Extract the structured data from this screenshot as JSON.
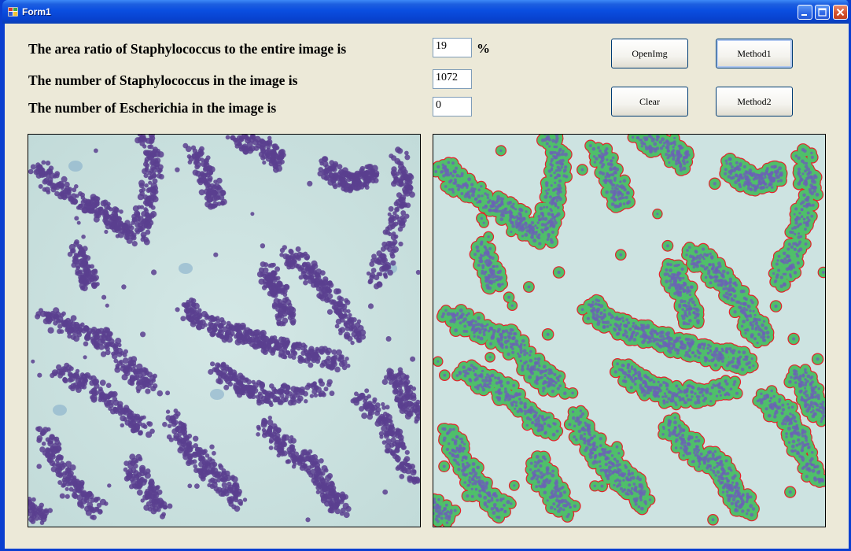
{
  "window": {
    "title": "Form1"
  },
  "labels": {
    "area_ratio": "The area ratio of Staphylococcus to the entire image is",
    "staph_count": "The number of Staphylococcus in the image is",
    "escherichia_count": "The number of Escherichia in the image is",
    "percent_unit": "%"
  },
  "fields": {
    "area_ratio_value": "19",
    "staph_count_value": "1072",
    "escherichia_count_value": "0"
  },
  "buttons": {
    "open_img": "OpenImg",
    "method1": "Method1",
    "clear": "Clear",
    "method2": "Method2"
  },
  "colors": {
    "cell_purple": "#5b3f8f",
    "background_teal": "#cfe4e2",
    "overlay_green": "#4fbf6a",
    "overlay_outline": "#e8202a"
  }
}
